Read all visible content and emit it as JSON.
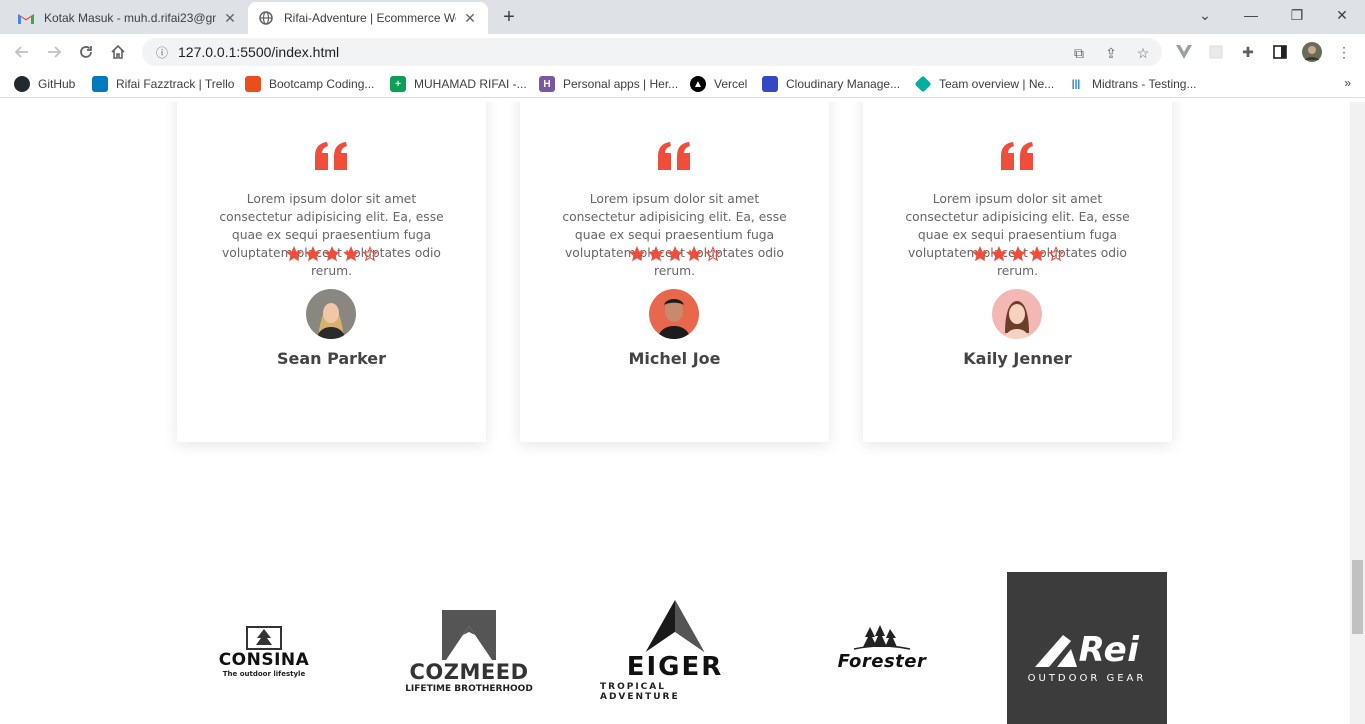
{
  "browser": {
    "tabs": [
      {
        "title": "Kotak Masuk - muh.d.rifai23@gm",
        "icon": "gmail-icon"
      },
      {
        "title": "Rifai-Adventure | Ecommerce We",
        "icon": "globe-icon"
      }
    ],
    "url": "127.0.0.1:5500/index.html",
    "bookmarks": [
      {
        "label": "GitHub",
        "icon": "github-icon",
        "color": "#24292f"
      },
      {
        "label": "Rifai Fazztrack | Trello",
        "icon": "trello-icon",
        "color": "#0079bf"
      },
      {
        "label": "Bootcamp Coding...",
        "icon": "bootcamp-icon",
        "color": "#e94e1b"
      },
      {
        "label": "MUHAMAD RIFAI -...",
        "icon": "sheets-icon",
        "color": "#0f9d58"
      },
      {
        "label": "Personal apps | Her...",
        "icon": "heroku-icon",
        "color": "#79589f"
      },
      {
        "label": "Vercel",
        "icon": "vercel-icon",
        "color": "#000000"
      },
      {
        "label": "Cloudinary Manage...",
        "icon": "cloudinary-icon",
        "color": "#3448c5"
      },
      {
        "label": "Team overview | Ne...",
        "icon": "netlify-icon",
        "color": "#00ad9f"
      },
      {
        "label": "Midtrans - Testing...",
        "icon": "midtrans-icon",
        "color": "#1a73e8"
      }
    ]
  },
  "testimonials": [
    {
      "text": "Lorem ipsum dolor sit amet consectetur adipisicing elit. Ea, esse quae ex sequi praesentium fuga voluptatem placeat voluptates odio rerum.",
      "rating": 4,
      "max_rating": 5,
      "name": "Sean Parker"
    },
    {
      "text": "Lorem ipsum dolor sit amet consectetur adipisicing elit. Ea, esse quae ex sequi praesentium fuga voluptatem placeat voluptates odio rerum.",
      "rating": 4,
      "max_rating": 5,
      "name": "Michel Joe"
    },
    {
      "text": "Lorem ipsum dolor sit amet consectetur adipisicing elit. Ea, esse quae ex sequi praesentium fuga voluptatem placeat voluptates odio rerum.",
      "rating": 4,
      "max_rating": 5,
      "name": "Kaily Jenner"
    }
  ],
  "brands": [
    {
      "name": "CONSINA",
      "tagline": "The outdoor lifestyle"
    },
    {
      "name": "COZMEED",
      "tagline": "LIFETIME BROTHERHOOD"
    },
    {
      "name": "EIGER",
      "tagline": "TROPICAL ADVENTURE"
    },
    {
      "name": "Forester",
      "tagline": ""
    },
    {
      "name": "Rei",
      "tagline": "OUTDOOR GEAR"
    }
  ],
  "colors": {
    "accent": "#f14d3b",
    "text_muted": "#666666",
    "name_text": "#444444"
  }
}
